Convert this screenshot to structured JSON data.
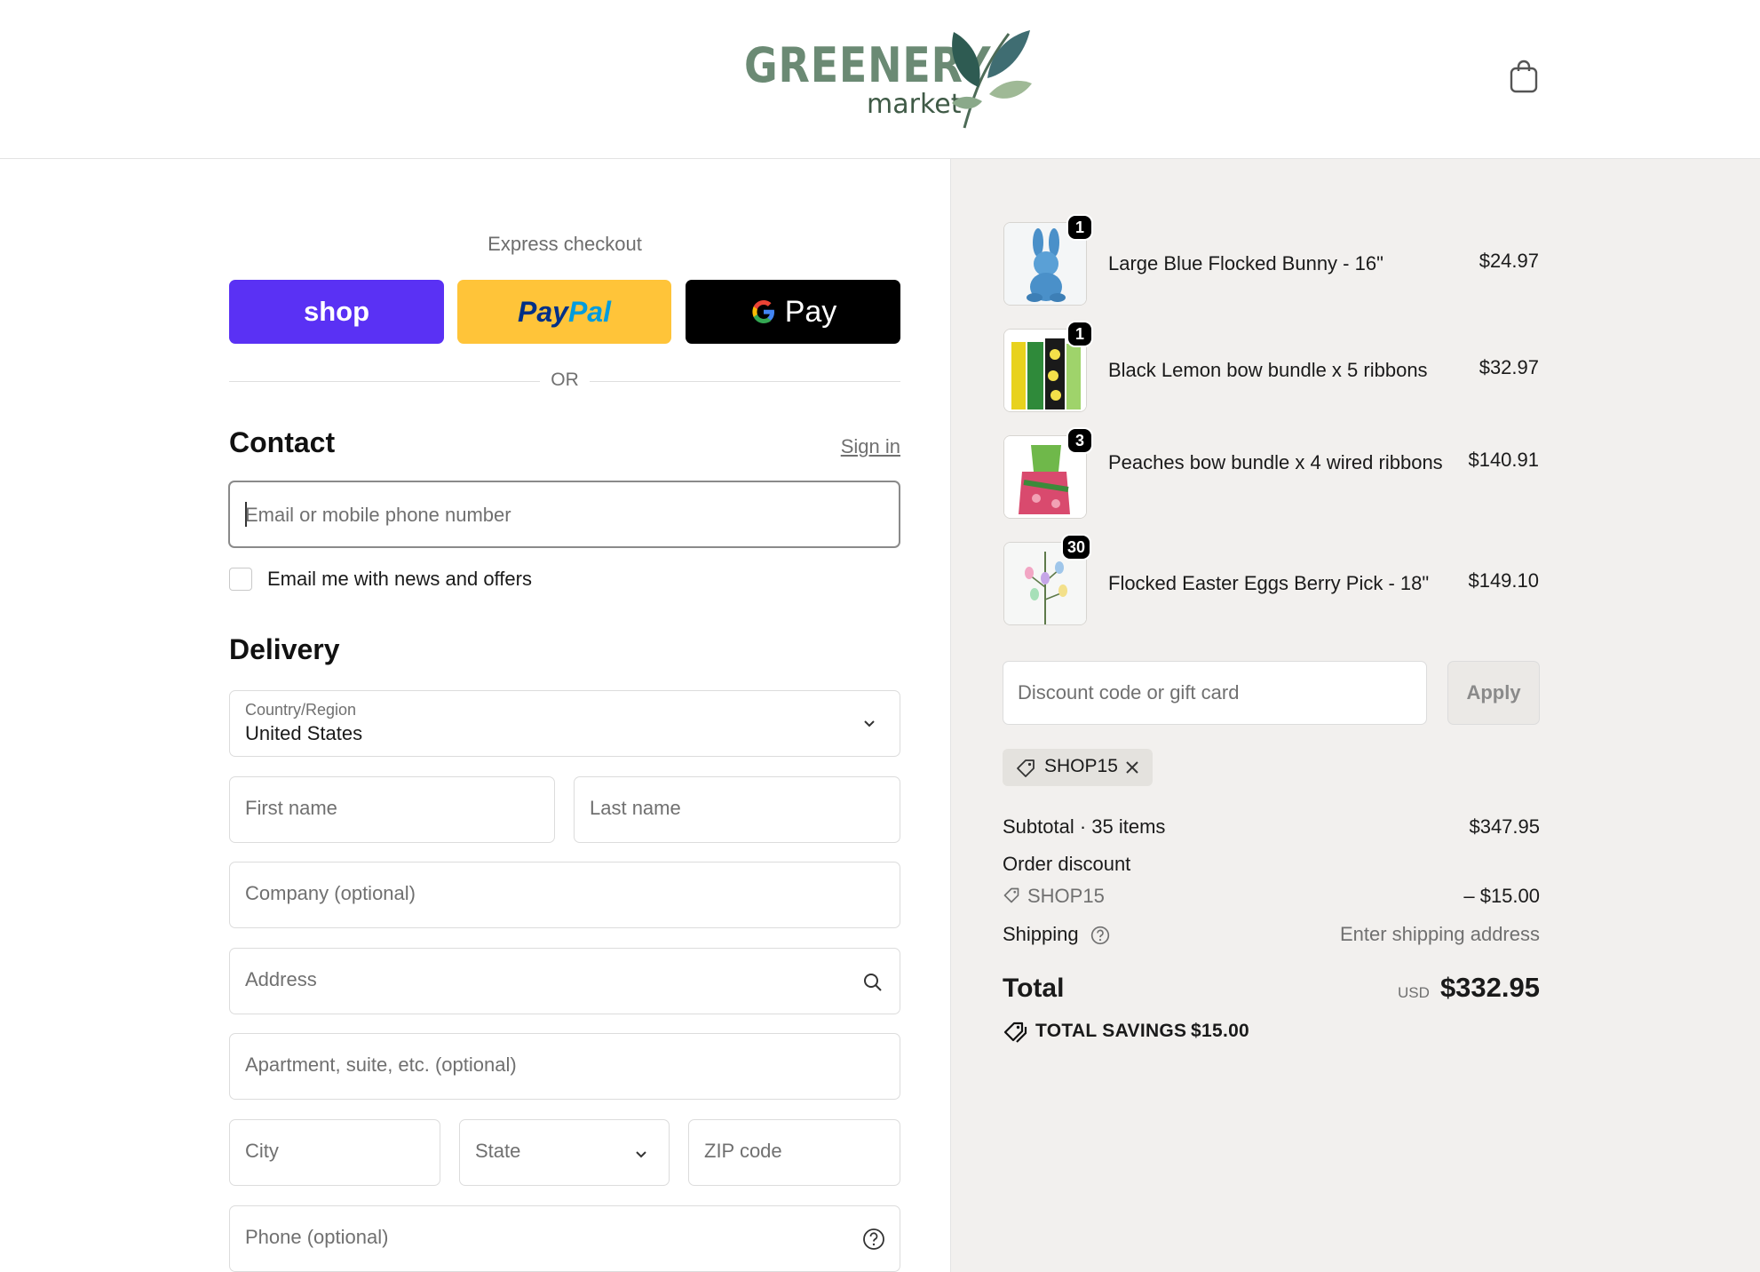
{
  "brand": {
    "name": "GREENERY",
    "sub": "market"
  },
  "express": {
    "title": "Express checkout",
    "shop_label": "shop",
    "paypal_label_a": "Pay",
    "paypal_label_b": "Pal",
    "gpay_label": "Pay",
    "or_label": "OR"
  },
  "contact": {
    "title": "Contact",
    "signin": "Sign in",
    "email_placeholder": "Email or mobile phone number",
    "newsletter_label": "Email me with news and offers"
  },
  "delivery": {
    "title": "Delivery",
    "country_label": "Country/Region",
    "country_value": "United States",
    "first_name": "First name",
    "last_name": "Last name",
    "company": "Company (optional)",
    "address": "Address",
    "apartment": "Apartment, suite, etc. (optional)",
    "city": "City",
    "state": "State",
    "zip": "ZIP code",
    "phone": "Phone (optional)"
  },
  "cart": {
    "items": [
      {
        "qty": "1",
        "name": "Large Blue Flocked Bunny - 16\"",
        "price": "$24.97"
      },
      {
        "qty": "1",
        "name": "Black Lemon bow bundle x 5 ribbons",
        "price": "$32.97"
      },
      {
        "qty": "3",
        "name": "Peaches bow bundle x 4 wired ribbons",
        "price": "$140.91"
      },
      {
        "qty": "30",
        "name": "Flocked Easter Eggs Berry Pick - 18\"",
        "price": "$149.10"
      }
    ],
    "discount_placeholder": "Discount code or gift card",
    "apply_label": "Apply",
    "applied_code": "SHOP15"
  },
  "summary": {
    "subtotal_label": "Subtotal · 35 items",
    "subtotal_value": "$347.95",
    "order_discount_label": "Order discount",
    "discount_code": "SHOP15",
    "discount_value": "– $15.00",
    "shipping_label": "Shipping",
    "shipping_value": "Enter shipping address",
    "total_label": "Total",
    "currency": "USD",
    "total_value": "$332.95",
    "savings_label": "TOTAL SAVINGS",
    "savings_value": "$15.00"
  },
  "colors": {
    "shop": "#5a31f4",
    "paypal": "#ffc439",
    "gpay": "#000000",
    "sidebar_bg": "#f2f0ee",
    "brand_green": "#6b8a74"
  }
}
